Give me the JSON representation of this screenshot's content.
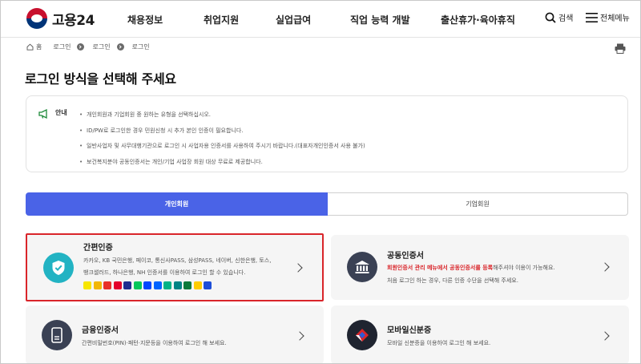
{
  "header": {
    "logo_text": "고용24",
    "nav": [
      "채용정보",
      "취업지원",
      "실업급여",
      "직업 능력 개발",
      "출산휴가·육아휴직"
    ],
    "search_label": "검색",
    "menu_label": "전체메뉴"
  },
  "breadcrumb": [
    "홈",
    "로그인",
    "로그인",
    "로그인"
  ],
  "page_title": "로그인 방식을 선택해 주세요",
  "notice": {
    "label": "안내",
    "items": [
      "개인회원과 기업회원 중 원하는 유형을 선택하십시오.",
      "ID/PW로 로그인한 경우 민원신청 시 추가 본인 인증이 필요합니다.",
      "일반사업자 및 사무대행기관으로 로그인 시 사업자용 인증서를 사용하여 주시기 바랍니다.(대표자개인인증서 사용 불가)",
      "보건복지분야 공동인증서는 개인/기업 사업장 회원 대상 무료로 제공합니다."
    ]
  },
  "tabs": {
    "personal": "개인회원",
    "corporate": "기업회원"
  },
  "cards": {
    "simple": {
      "title": "간편인증",
      "desc_line1": "카카오, KB 국민은행, 페이코, 통신사PASS, 삼성PASS, 네이버, 신한은행, 토스,",
      "desc_line2": "뱅크샐러드, 하나은행, NH 인증서를 이용하여 로그인 할 수 있습니다.",
      "bank_icons": [
        "kakao-icon",
        "kb-icon",
        "payco-icon",
        "pass-icon",
        "samsung-pass-icon",
        "naver-icon",
        "shinhan-icon",
        "toss-icon",
        "banksalad-icon",
        "hana-icon",
        "nh-icon",
        "kb-star-icon",
        "bank-icon-extra"
      ],
      "bank_colors": [
        "#f7e600",
        "#f2b705",
        "#e8302a",
        "#e4002b",
        "#1f2c8f",
        "#03c75a",
        "#0046ff",
        "#0064ff",
        "#00b386",
        "#008485",
        "#0a7a3a",
        "#ffcc00",
        "#1d4ed8"
      ]
    },
    "joint": {
      "title": "공동인증서",
      "desc_highlight": "회원인증서 관리 메뉴에서 공동인증서를 등록",
      "desc_rest": "해주셔야 이용이 가능해요.",
      "desc_line2": "처음 로그인 하는 경우, 다른 인증 수단을 선택해 주세요."
    },
    "finance": {
      "title": "금융인증서",
      "desc": "간편비밀번호(PIN)·패턴·지문등을 이용하여 로그인 해 보세요."
    },
    "mobile": {
      "title": "모바일신분증",
      "desc": "모바일 신분증을 이용하여 로그인 해 보세요."
    }
  },
  "colors": {
    "accent": "#4a63e7",
    "highlight": "#d9252a",
    "simple_icon": "#22b3c3",
    "dark_icon": "#3a4154"
  }
}
